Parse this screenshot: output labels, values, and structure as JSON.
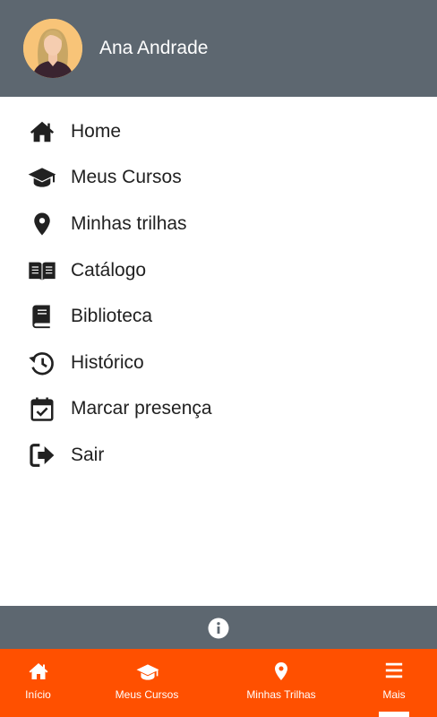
{
  "header": {
    "user_name": "Ana Andrade",
    "background": "#5d6770"
  },
  "menu": {
    "items": [
      {
        "label": "Home",
        "icon": "home-icon"
      },
      {
        "label": "Meus Cursos",
        "icon": "graduation-cap-icon"
      },
      {
        "label": "Minhas trilhas",
        "icon": "map-pin-icon"
      },
      {
        "label": "Catálogo",
        "icon": "open-book-icon"
      },
      {
        "label": "Biblioteca",
        "icon": "book-icon"
      },
      {
        "label": "Histórico",
        "icon": "history-icon"
      },
      {
        "label": "Marcar presença",
        "icon": "calendar-check-icon"
      },
      {
        "label": "Sair",
        "icon": "logout-icon"
      }
    ]
  },
  "info_bar": {
    "icon": "info-icon"
  },
  "bottom_nav": {
    "background": "#ff5000",
    "items": [
      {
        "label": "Início",
        "icon": "home-icon"
      },
      {
        "label": "Meus Cursos",
        "icon": "graduation-cap-icon"
      },
      {
        "label": "Minhas Trilhas",
        "icon": "map-pin-icon"
      },
      {
        "label": "Mais",
        "icon": "menu-icon",
        "active": true
      }
    ]
  }
}
